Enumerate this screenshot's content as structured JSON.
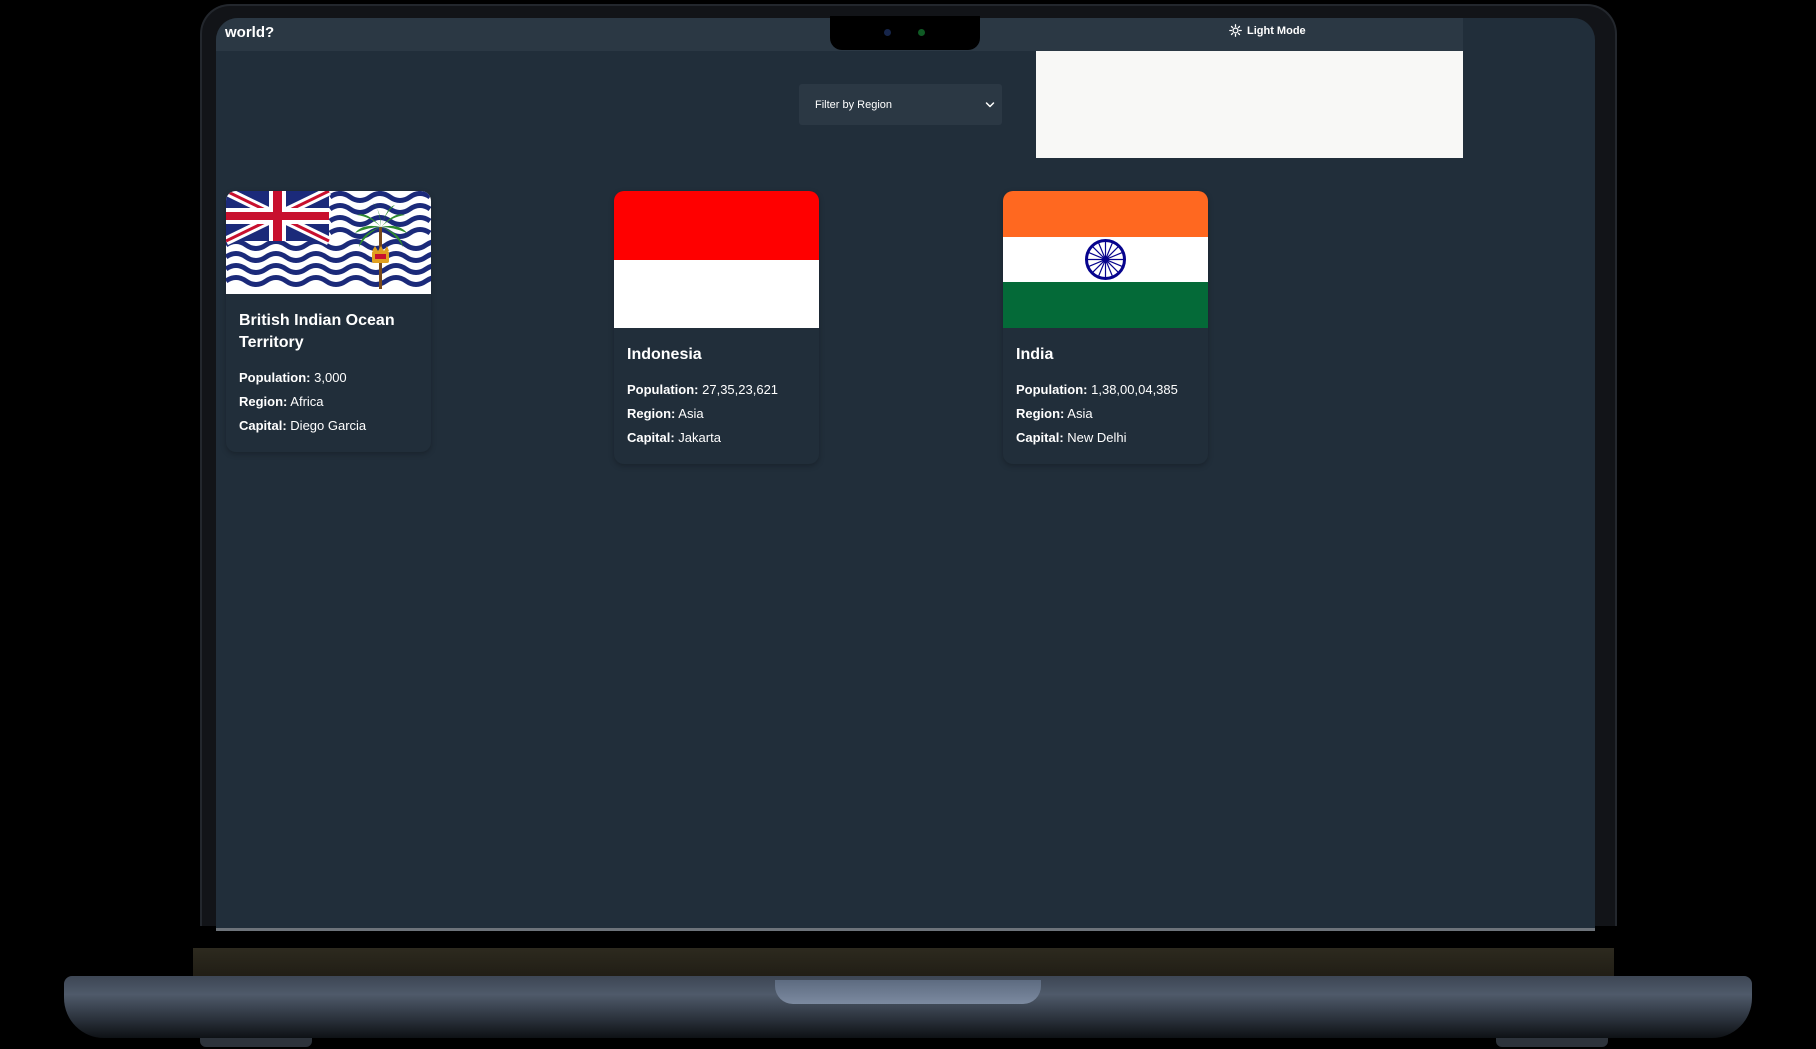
{
  "header": {
    "brand": "world?",
    "mode_toggle_label": "Light Mode",
    "mode_icon": "sun-icon"
  },
  "filter": {
    "placeholder": "Filter by Region"
  },
  "labels": {
    "population": "Population:",
    "region": "Region:",
    "capital": "Capital:"
  },
  "countries": [
    {
      "name": "British Indian Ocean Territory",
      "population": "3,000",
      "region": "Africa",
      "capital": "Diego Garcia",
      "flag": "biot-flag"
    },
    {
      "name": "Indonesia",
      "population": "27,35,23,621",
      "region": "Asia",
      "capital": "Jakarta",
      "flag": "indonesia-flag",
      "colors": [
        "#ff0000",
        "#ffffff"
      ]
    },
    {
      "name": "India",
      "population": "1,38,00,04,385",
      "region": "Asia",
      "capital": "New Delhi",
      "flag": "india-flag",
      "colors": [
        "#ff6820",
        "#ffffff",
        "#046a38",
        "#06038d"
      ]
    }
  ],
  "theme": {
    "background": "#212e3a",
    "element": "#2b3844",
    "text": "#ffffff"
  }
}
